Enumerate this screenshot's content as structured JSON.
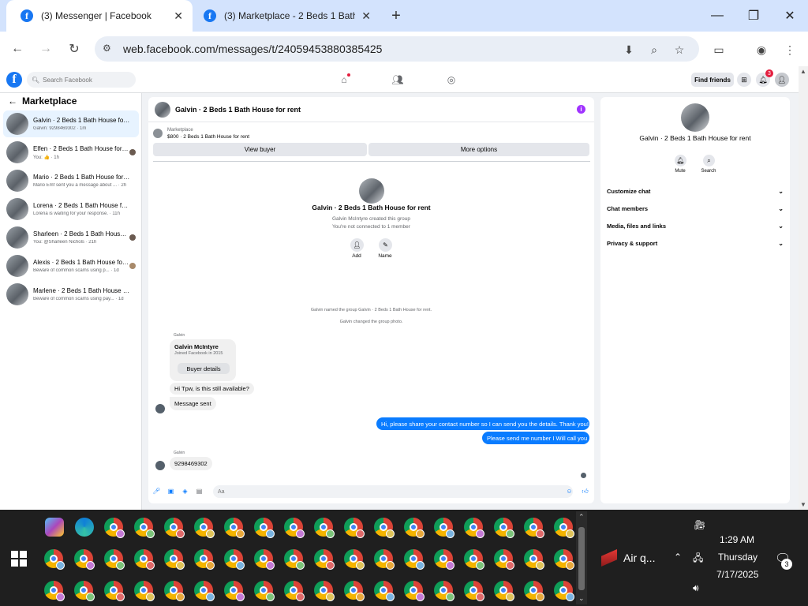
{
  "browser": {
    "tabs": [
      {
        "title": "(3) Messenger | Facebook",
        "active": true
      },
      {
        "title": "(3) Marketplace - 2 Beds 1 Bath",
        "active": false
      }
    ],
    "url": "web.facebook.com/messages/t/24059453880385425"
  },
  "fb": {
    "search_placeholder": "Search Facebook",
    "find_friends": "Find friends",
    "notification_count": "3"
  },
  "sidebar": {
    "title": "Marketplace",
    "conversations": [
      {
        "name": "Galvin · 2 Beds 1 Bath House for rent",
        "preview": "Galvin: 9298469302 · 1m",
        "selected": true
      },
      {
        "name": "Elfen · 2 Beds 1 Bath House for r...",
        "preview": "You: 👍 · 1h",
        "selected": false
      },
      {
        "name": "Mario · 2 Beds 1 Bath House for rent",
        "preview": "Mario Emf sent you a message about ... · 2h",
        "selected": false
      },
      {
        "name": "Lorena · 2 Beds 1 Bath House for r...",
        "preview": "Lorena is waiting for your response. · 11h",
        "selected": false
      },
      {
        "name": "Sharleen · 2 Beds 1 Bath House f...",
        "preview": "You: @Sharleen Nichols · 21h",
        "selected": false
      },
      {
        "name": "Alexis · 2 Beds 1 Bath House for ...",
        "preview": "Beware of common scams using p... · 1d",
        "selected": false
      },
      {
        "name": "Marlene · 2 Beds 1 Bath House for ...",
        "preview": "Beware of common scams using pay... · 1d",
        "selected": false
      }
    ]
  },
  "chat": {
    "title": "Galvin · 2 Beds 1 Bath House for rent",
    "marketplace_label": "Marketplace",
    "listing": "$800 · 2 Beds 1 Bath House for rent",
    "view_buyer": "View buyer",
    "more_options": "More options",
    "group_name": "Galvin · 2 Beds 1 Bath House for rent",
    "created_by": "Galvin McIntyre created this group",
    "not_connected": "You're not connected to 1 member",
    "add_label": "Add",
    "name_label": "Name",
    "sys_named": "Galvin named the group Galvin · 2 Beds 1 Bath House for rent.",
    "sys_photo": "Galvin changed the group photo.",
    "sender1": "Galvin",
    "buyer_name": "Galvin McIntyre",
    "buyer_joined": "Joined Facebook in 2015",
    "buyer_details": "Buyer details",
    "msg_available": "Hi Tpw, is this still available?",
    "msg_sent": "Message sent",
    "msg_me1": "Hi, please share your contact number so I can send you the details. Thank you!",
    "msg_me2": "Please send me number I Will call you",
    "sender2": "Galvin",
    "msg_number": "9298469302",
    "composer_placeholder": "Aa"
  },
  "right": {
    "name": "Galvin · 2 Beds 1 Bath House for rent",
    "mute": "Mute",
    "search": "Search",
    "sections": [
      "Customize chat",
      "Chat members",
      "Media, files and links",
      "Privacy & support"
    ]
  },
  "taskbar": {
    "weather": "Air q...",
    "time": "1:29 AM",
    "day": "Thursday",
    "date": "7/17/2025",
    "notif_count": "3"
  }
}
